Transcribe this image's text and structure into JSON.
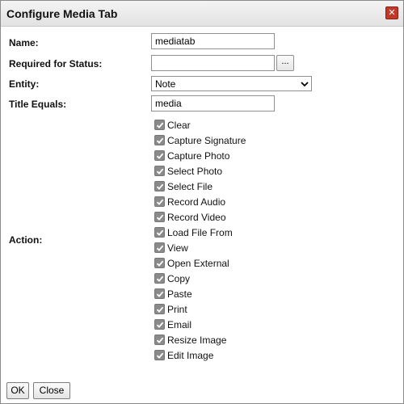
{
  "dialog": {
    "title": "Configure Media Tab",
    "close_icon": "close-icon",
    "close_color": "#c0392b"
  },
  "form": {
    "name_label": "Name:",
    "name_value": "mediatab",
    "required_label": "Required for Status:",
    "required_value": "",
    "browse_label": "...",
    "entity_label": "Entity:",
    "entity_value": "Note",
    "title_label": "Title Equals:",
    "title_value": "media",
    "action_label": "Action:"
  },
  "actions": [
    {
      "label": "Clear",
      "checked": true
    },
    {
      "label": "Capture Signature",
      "checked": true
    },
    {
      "label": "Capture Photo",
      "checked": true
    },
    {
      "label": "Select Photo",
      "checked": true
    },
    {
      "label": "Select File",
      "checked": true
    },
    {
      "label": "Record Audio",
      "checked": true
    },
    {
      "label": "Record Video",
      "checked": true
    },
    {
      "label": "Load File From",
      "checked": true
    },
    {
      "label": "View",
      "checked": true
    },
    {
      "label": "Open External",
      "checked": true
    },
    {
      "label": "Copy",
      "checked": true
    },
    {
      "label": "Paste",
      "checked": true
    },
    {
      "label": "Print",
      "checked": true
    },
    {
      "label": "Email",
      "checked": true
    },
    {
      "label": "Resize Image",
      "checked": true
    },
    {
      "label": "Edit Image",
      "checked": true
    }
  ],
  "footer": {
    "ok_label": "OK",
    "close_label": "Close"
  }
}
